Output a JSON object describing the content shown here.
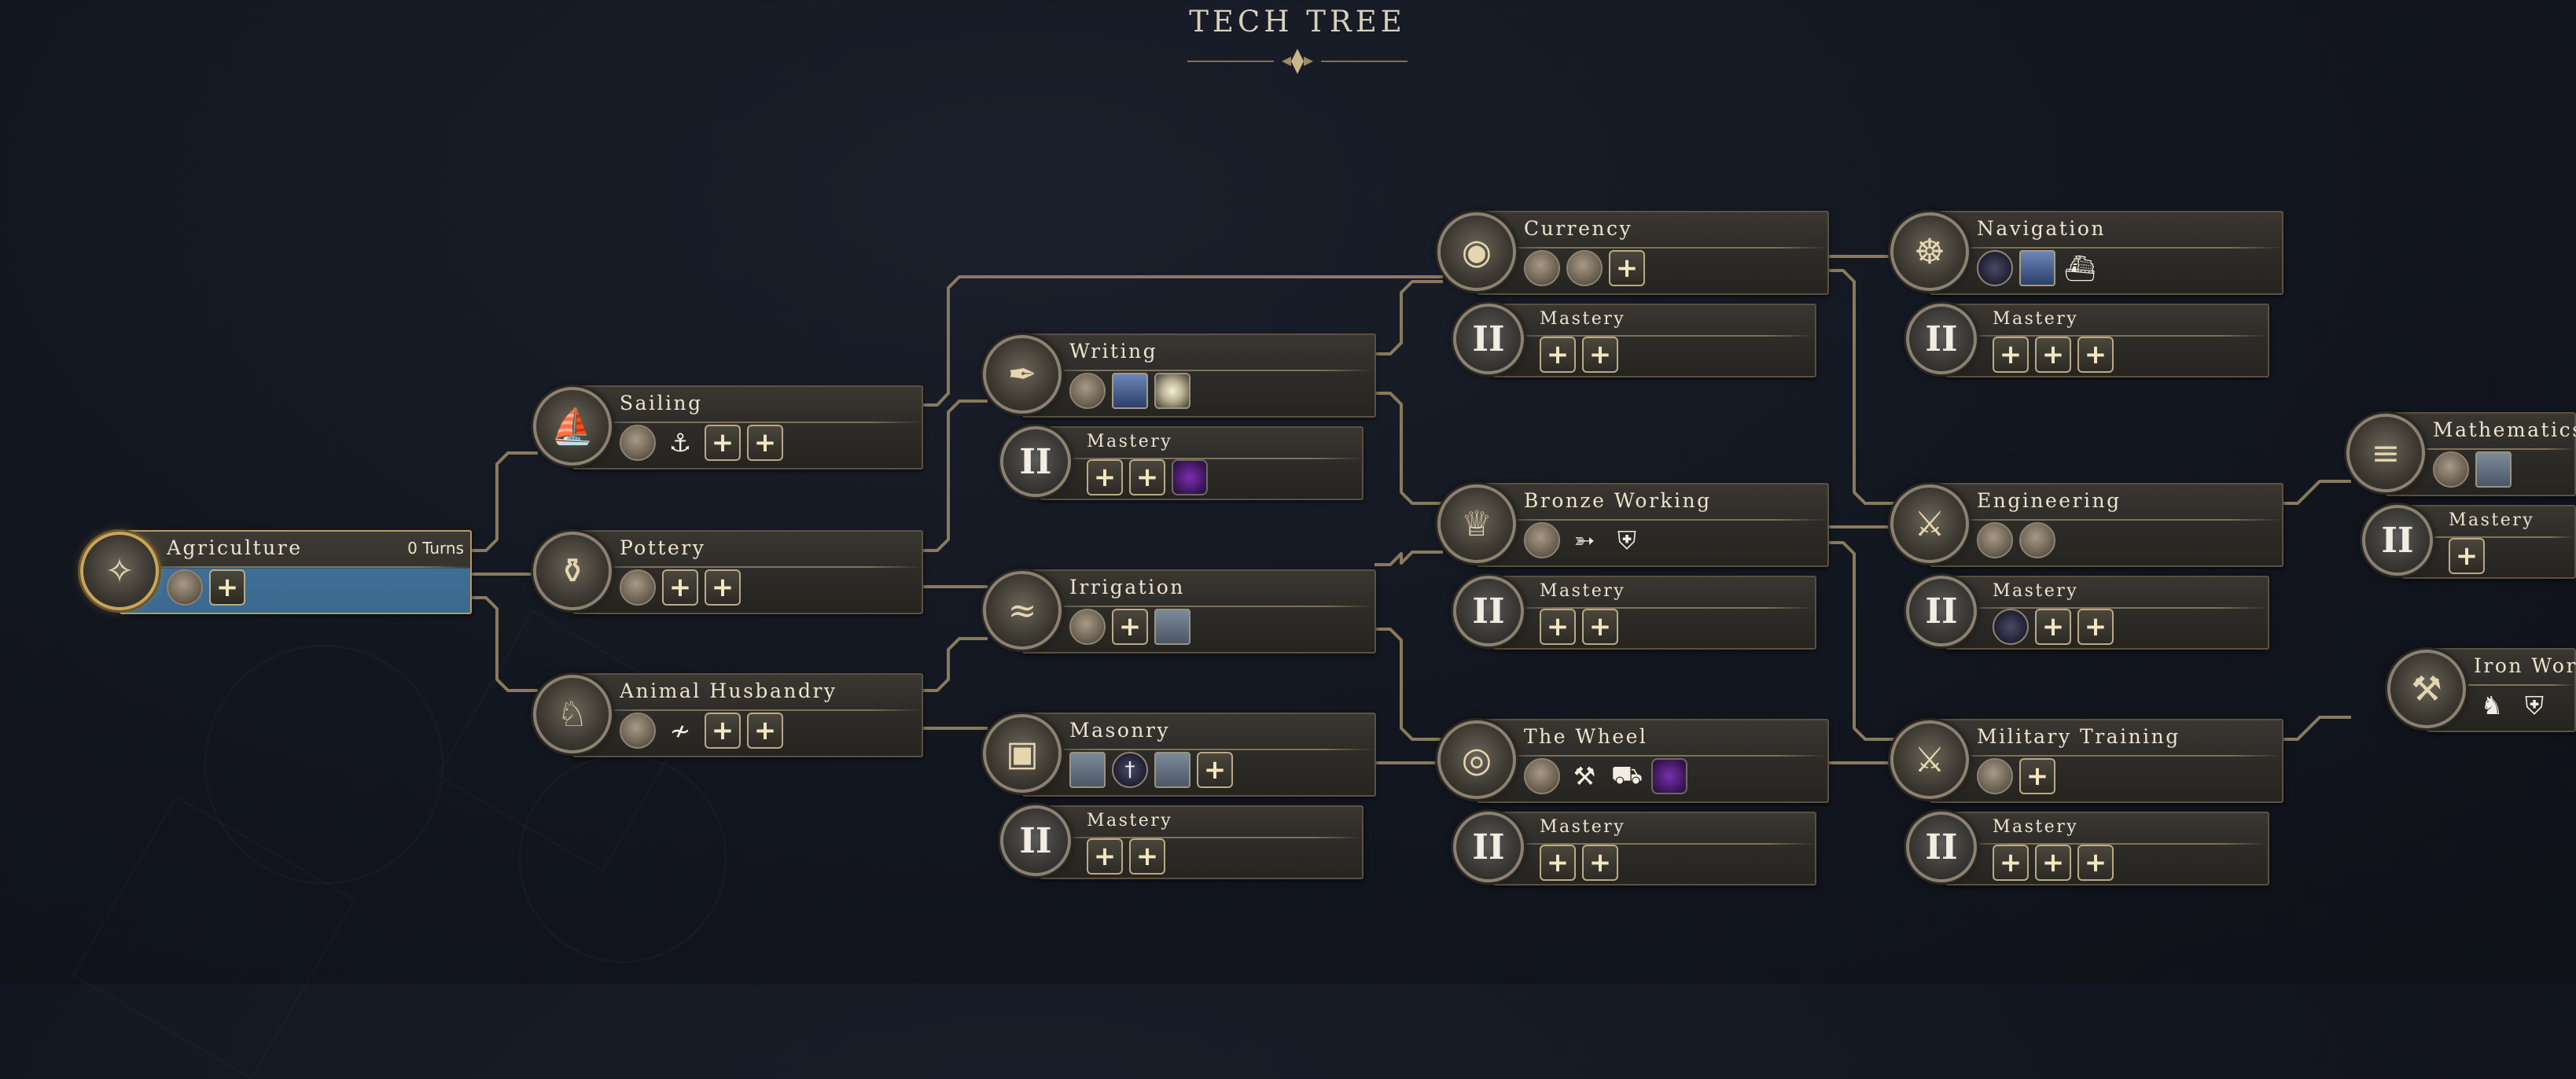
{
  "title": "TECH TREE",
  "nodes": [
    {
      "id": "agriculture",
      "label": "Agriculture",
      "turns": "0 Turns",
      "icon": "wheat-icon",
      "glyph": "✧",
      "active": true,
      "unlocks": [
        {
          "name": "granary-icon",
          "kind": "round",
          "glyph": ""
        },
        {
          "name": "plus-icon",
          "kind": "plus",
          "glyph": "+"
        }
      ]
    },
    {
      "id": "sailing",
      "label": "Sailing",
      "icon": "sailboat-icon",
      "glyph": "⛵",
      "unlocks": [
        {
          "name": "harbor-icon",
          "kind": "round",
          "glyph": ""
        },
        {
          "name": "boat-icon",
          "kind": "bare",
          "glyph": "⚓"
        },
        {
          "name": "plus-icon",
          "kind": "plus",
          "glyph": "+"
        },
        {
          "name": "plus-icon",
          "kind": "plus",
          "glyph": "+"
        }
      ]
    },
    {
      "id": "pottery",
      "label": "Pottery",
      "icon": "vase-icon",
      "glyph": "⚱",
      "unlocks": [
        {
          "name": "kiln-icon",
          "kind": "round",
          "glyph": ""
        },
        {
          "name": "plus-icon",
          "kind": "plus",
          "glyph": "+"
        },
        {
          "name": "plus-icon",
          "kind": "plus",
          "glyph": "+"
        }
      ]
    },
    {
      "id": "animal-husbandry",
      "label": "Animal Husbandry",
      "icon": "cow-icon",
      "glyph": "♘",
      "unlocks": [
        {
          "name": "pasture-icon",
          "kind": "round",
          "glyph": ""
        },
        {
          "name": "road-icon",
          "kind": "bare",
          "glyph": "≁"
        },
        {
          "name": "plus-icon",
          "kind": "plus",
          "glyph": "+"
        },
        {
          "name": "plus-icon",
          "kind": "plus",
          "glyph": "+"
        }
      ]
    },
    {
      "id": "writing",
      "label": "Writing",
      "icon": "quill-icon",
      "glyph": "✒",
      "unlocks": [
        {
          "name": "library-icon",
          "kind": "round",
          "glyph": ""
        },
        {
          "name": "monument-icon",
          "kind": "blue",
          "glyph": ""
        },
        {
          "name": "lightbulb-icon",
          "kind": "bulb",
          "glyph": ""
        }
      ]
    },
    {
      "id": "writing-mastery",
      "label": "Mastery",
      "mastery": true,
      "glyph": "II",
      "unlocks": [
        {
          "name": "plus-icon",
          "kind": "plus",
          "glyph": "+"
        },
        {
          "name": "plus-icon",
          "kind": "plus",
          "glyph": "+"
        },
        {
          "name": "purple-gem-icon",
          "kind": "purple",
          "glyph": ""
        }
      ]
    },
    {
      "id": "irrigation",
      "label": "Irrigation",
      "icon": "canal-icon",
      "glyph": "≈",
      "unlocks": [
        {
          "name": "farm-icon",
          "kind": "round",
          "glyph": ""
        },
        {
          "name": "plus-icon",
          "kind": "plus",
          "glyph": "+"
        },
        {
          "name": "aqueduct-icon",
          "kind": "square",
          "glyph": ""
        }
      ]
    },
    {
      "id": "masonry",
      "label": "Masonry",
      "icon": "stone-block-icon",
      "glyph": "▣",
      "unlocks": [
        {
          "name": "wall-icon",
          "kind": "square",
          "glyph": ""
        },
        {
          "name": "obelisk-icon",
          "kind": "dark",
          "glyph": "†"
        },
        {
          "name": "palace-icon",
          "kind": "square",
          "glyph": ""
        },
        {
          "name": "plus-icon",
          "kind": "plus",
          "glyph": "+"
        }
      ]
    },
    {
      "id": "masonry-mastery",
      "label": "Mastery",
      "mastery": true,
      "glyph": "II",
      "unlocks": [
        {
          "name": "plus-icon",
          "kind": "plus",
          "glyph": "+"
        },
        {
          "name": "plus-icon",
          "kind": "plus",
          "glyph": "+"
        }
      ]
    },
    {
      "id": "currency",
      "label": "Currency",
      "icon": "coin-icon",
      "glyph": "◉",
      "unlocks": [
        {
          "name": "market-icon",
          "kind": "round",
          "glyph": ""
        },
        {
          "name": "bank-icon",
          "kind": "round",
          "glyph": ""
        },
        {
          "name": "plus-icon",
          "kind": "plus",
          "glyph": "+"
        }
      ]
    },
    {
      "id": "currency-mastery",
      "label": "Mastery",
      "mastery": true,
      "glyph": "II",
      "unlocks": [
        {
          "name": "plus-icon",
          "kind": "plus",
          "glyph": "+"
        },
        {
          "name": "plus-icon",
          "kind": "plus",
          "glyph": "+"
        }
      ]
    },
    {
      "id": "bronze-working",
      "label": "Bronze Working",
      "icon": "bronze-helmet-icon",
      "glyph": "♕",
      "unlocks": [
        {
          "name": "barracks-icon",
          "kind": "round",
          "glyph": ""
        },
        {
          "name": "bow-icon",
          "kind": "bare",
          "glyph": "➳"
        },
        {
          "name": "helmet-icon",
          "kind": "bare",
          "glyph": "⛨"
        }
      ]
    },
    {
      "id": "bronze-mastery",
      "label": "Mastery",
      "mastery": true,
      "glyph": "II",
      "unlocks": [
        {
          "name": "plus-icon",
          "kind": "plus",
          "glyph": "+"
        },
        {
          "name": "plus-icon",
          "kind": "plus",
          "glyph": "+"
        }
      ]
    },
    {
      "id": "the-wheel",
      "label": "The Wheel",
      "icon": "wheel-icon",
      "glyph": "◎",
      "unlocks": [
        {
          "name": "workshop-icon",
          "kind": "round",
          "glyph": ""
        },
        {
          "name": "digging-icon",
          "kind": "bare",
          "glyph": "⚒"
        },
        {
          "name": "cart-icon",
          "kind": "bare",
          "glyph": "⛟"
        },
        {
          "name": "purple-gem-icon",
          "kind": "purple",
          "glyph": ""
        }
      ]
    },
    {
      "id": "wheel-mastery",
      "label": "Mastery",
      "mastery": true,
      "glyph": "II",
      "unlocks": [
        {
          "name": "plus-icon",
          "kind": "plus",
          "glyph": "+"
        },
        {
          "name": "plus-icon",
          "kind": "plus",
          "glyph": "+"
        }
      ]
    },
    {
      "id": "navigation",
      "label": "Navigation",
      "icon": "compass-icon",
      "glyph": "☸",
      "unlocks": [
        {
          "name": "lighthouse-icon",
          "kind": "dark",
          "glyph": ""
        },
        {
          "name": "shipyard-icon",
          "kind": "blue",
          "glyph": ""
        },
        {
          "name": "ship-icon",
          "kind": "bare",
          "glyph": "⛴"
        }
      ]
    },
    {
      "id": "navigation-mastery",
      "label": "Mastery",
      "mastery": true,
      "glyph": "II",
      "unlocks": [
        {
          "name": "plus-icon",
          "kind": "plus",
          "glyph": "+"
        },
        {
          "name": "plus-icon",
          "kind": "plus",
          "glyph": "+"
        },
        {
          "name": "plus-icon",
          "kind": "plus",
          "glyph": "+"
        }
      ]
    },
    {
      "id": "engineering",
      "label": "Engineering",
      "icon": "crossed-tools-icon",
      "glyph": "⚔",
      "unlocks": [
        {
          "name": "quarry-icon",
          "kind": "round",
          "glyph": ""
        },
        {
          "name": "fort-icon",
          "kind": "round",
          "glyph": ""
        }
      ]
    },
    {
      "id": "engineering-mastery",
      "label": "Mastery",
      "mastery": true,
      "glyph": "II",
      "unlocks": [
        {
          "name": "dark-site-icon",
          "kind": "dark",
          "glyph": ""
        },
        {
          "name": "plus-icon",
          "kind": "plus",
          "glyph": "+"
        },
        {
          "name": "plus-icon",
          "kind": "plus",
          "glyph": "+"
        }
      ]
    },
    {
      "id": "military-training",
      "label": "Military Training",
      "icon": "soldier-icon",
      "glyph": "⚔",
      "unlocks": [
        {
          "name": "training-ground-icon",
          "kind": "round",
          "glyph": ""
        },
        {
          "name": "plus-icon",
          "kind": "plus",
          "glyph": "+"
        }
      ]
    },
    {
      "id": "military-mastery",
      "label": "Mastery",
      "mastery": true,
      "glyph": "II",
      "unlocks": [
        {
          "name": "plus-icon",
          "kind": "plus",
          "glyph": "+"
        },
        {
          "name": "plus-icon",
          "kind": "plus",
          "glyph": "+"
        },
        {
          "name": "plus-icon",
          "kind": "plus",
          "glyph": "+"
        }
      ]
    },
    {
      "id": "mathematics",
      "label": "Mathematics",
      "icon": "abacus-icon",
      "glyph": "≡",
      "unlocks": [
        {
          "name": "academy-icon",
          "kind": "round",
          "glyph": ""
        },
        {
          "name": "observatory-icon",
          "kind": "square",
          "glyph": ""
        }
      ]
    },
    {
      "id": "mathematics-mastery",
      "label": "Mastery",
      "mastery": true,
      "glyph": "II",
      "unlocks": [
        {
          "name": "plus-icon",
          "kind": "plus",
          "glyph": "+"
        }
      ]
    },
    {
      "id": "iron-working",
      "label": "Iron Working",
      "icon": "anvil-icon",
      "glyph": "⚒",
      "unlocks": [
        {
          "name": "cavalry-icon",
          "kind": "bare",
          "glyph": "♞"
        },
        {
          "name": "helmet-icon",
          "kind": "bare",
          "glyph": "⛨"
        }
      ]
    }
  ]
}
